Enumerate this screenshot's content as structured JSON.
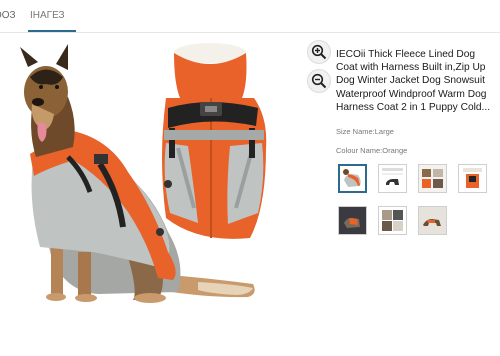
{
  "tabs": [
    {
      "label": "ООЗ"
    },
    {
      "label": "ІНАГЕЗ"
    }
  ],
  "product": {
    "title": "IECOii Thick Fleece Lined Dog Coat with Harness Built in,Zip Up Dog Winter Jacket Dog Snowsuit Waterproof Windproof Warm Dog Harness Coat 2 in 1 Puppy Cold...",
    "size_label": "Size Name:",
    "size_value": "Large",
    "colour_label": "Colour Name:",
    "colour_value": "Orange"
  },
  "controls": {
    "zoom_in_icon": "zoom-in-icon",
    "zoom_out_icon": "zoom-out-icon"
  },
  "colors": {
    "accent": "#2c6b8f",
    "coat_orange": "#e8622a",
    "coat_grey": "#bfc4c3"
  },
  "thumbnails": [
    {
      "name": "dog-wearing-coat",
      "selected": true
    },
    {
      "name": "size-chart",
      "selected": false
    },
    {
      "name": "features",
      "selected": false
    },
    {
      "name": "coat-closeup",
      "selected": false
    },
    {
      "name": "night-walk",
      "selected": false
    },
    {
      "name": "detail-grid",
      "selected": false
    },
    {
      "name": "dog-outdoors",
      "selected": false
    }
  ]
}
